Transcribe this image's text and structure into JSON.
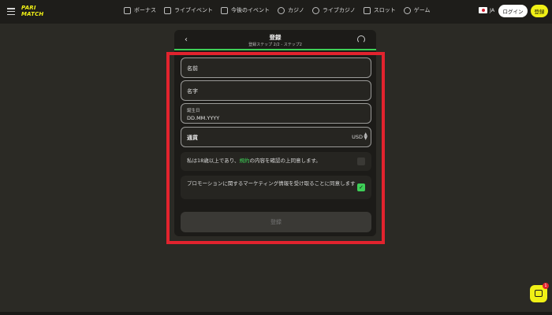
{
  "logo": {
    "line1": "PARI",
    "line2": "MATCH"
  },
  "nav": {
    "items": [
      {
        "label": "ボーナス",
        "icon": "gift-icon"
      },
      {
        "label": "ライブイベント",
        "icon": "live-tv-icon"
      },
      {
        "label": "今後のイベント",
        "icon": "calendar-icon"
      },
      {
        "label": "カジノ",
        "icon": "casino-chip-icon"
      },
      {
        "label": "ライブカジノ",
        "icon": "live-casino-icon"
      },
      {
        "label": "スロット",
        "icon": "slot-icon"
      },
      {
        "label": "ゲーム",
        "icon": "rocket-icon"
      }
    ]
  },
  "header": {
    "language": "JA",
    "login_label": "ログイン",
    "register_label": "登録"
  },
  "form": {
    "title": "登録",
    "subtitle": "登録ステップ 2/2 - ステップ2",
    "first_name_label": "名前",
    "last_name_label": "名字",
    "birth_label": "誕生日",
    "birth_placeholder": "DD.MM.YYYY",
    "currency_label": "通貨",
    "currency_value": "USD",
    "age_text_before": "私は18歳以上であり、",
    "age_text_link": "規約",
    "age_text_after": "の内容を確認の上同意します。",
    "promo_text": "プロモーションに関するマーケティング情報を受け取ることに同意します",
    "submit_label": "登録",
    "age_checked": false,
    "promo_checked": true
  },
  "colors": {
    "accent": "#3ecf57",
    "brand": "#f0f016",
    "highlight": "#e2232e"
  },
  "chat": {
    "badge": "1"
  }
}
